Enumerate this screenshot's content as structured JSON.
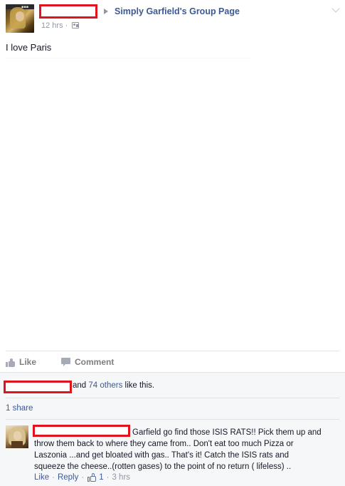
{
  "post": {
    "group_name": "Simply Garfield's Group Page",
    "time": "12 hrs",
    "time_separator": "·",
    "audience_icon": "group-audience-icon",
    "text": "I love Paris"
  },
  "actions": {
    "like_label": "Like",
    "comment_label": "Comment"
  },
  "likes": {
    "prefix": "and ",
    "others_link": "74 others",
    "suffix": " like this."
  },
  "shares": {
    "label": "1 share"
  },
  "comment": {
    "lines": [
      "Garfield go find those ISIS RATS!! Pick them up and",
      "throw them back to where they came from.. Don't eat too much Pizza or",
      "Laszonia ...and get bloated with gas.. That's it! Catch the ISIS rats and",
      "squeeze the cheese..(rotten gases) to the point of no return ( lifeless) .."
    ],
    "like_label": "Like",
    "reply_label": "Reply",
    "like_count": "1",
    "time": "3 hrs",
    "separator": "·"
  },
  "colors": {
    "link": "#3b5998",
    "redaction": "#e0141e",
    "meta_gray": "#9197a3",
    "ufi_background": "#f6f7f9"
  }
}
